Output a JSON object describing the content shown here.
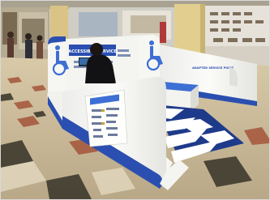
{
  "photo": {
    "subject": "Accessible wheelchair service booth in a shopping mall",
    "signs": {
      "service_banner": "ACCESSIBLE SERVICE",
      "side_label": "ADAPTED SERVICE POINT"
    }
  },
  "colors": {
    "mall_floor_cream": "#e9dfc8",
    "mall_floor_terracotta": "#a4553a",
    "mall_floor_dark": "#3e3a2e",
    "booth_panel": "#f5f5f2",
    "booth_trim": "#2a4fb0",
    "bench_blue": "#3d6fd4",
    "ramp_stripe": "#ffffff",
    "ramp_dark": "#1e3a8a",
    "column": "#d9c486"
  },
  "icons": [
    "wheelchair-symbol-icon",
    "wheelchair-symbol-icon"
  ]
}
